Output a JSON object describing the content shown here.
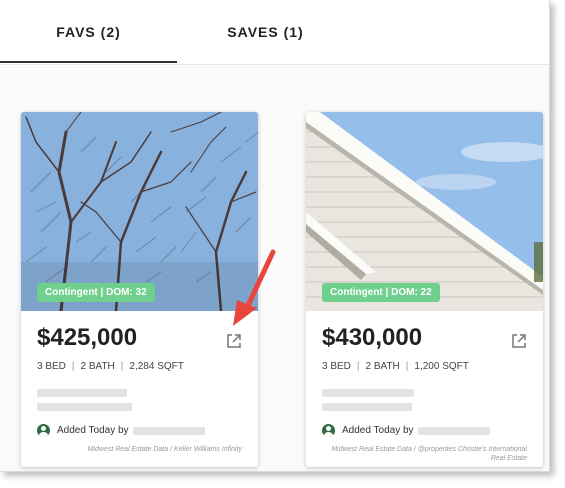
{
  "tabs": [
    {
      "label": "FAVS (2)",
      "active": true
    },
    {
      "label": "SAVES (1)",
      "active": false
    }
  ],
  "listings": [
    {
      "status": "Contingent | DOM: 32",
      "price": "$425,000",
      "beds": "3 BED",
      "baths": "2 BATH",
      "sqft": "2,284 SQFT",
      "added": "Added Today by",
      "source": "Midwest Real Estate Data / Keller Williams Infinity",
      "photo": "bare-trees"
    },
    {
      "status": "Contingent | DOM: 22",
      "price": "$430,000",
      "beds": "3 BED",
      "baths": "2 BATH",
      "sqft": "1,200 SQFT",
      "added": "Added Today by",
      "source": "Midwest Real Estate Data / @properties Christie's International Real Estate",
      "photo": "house-roof"
    }
  ],
  "icons": {
    "share": "external-link-icon",
    "agent": "account-circle-icon"
  },
  "colors": {
    "status_badge": "#6fcf8d",
    "annotation_arrow": "#e8453c",
    "agent_icon": "#2e6b3e"
  }
}
